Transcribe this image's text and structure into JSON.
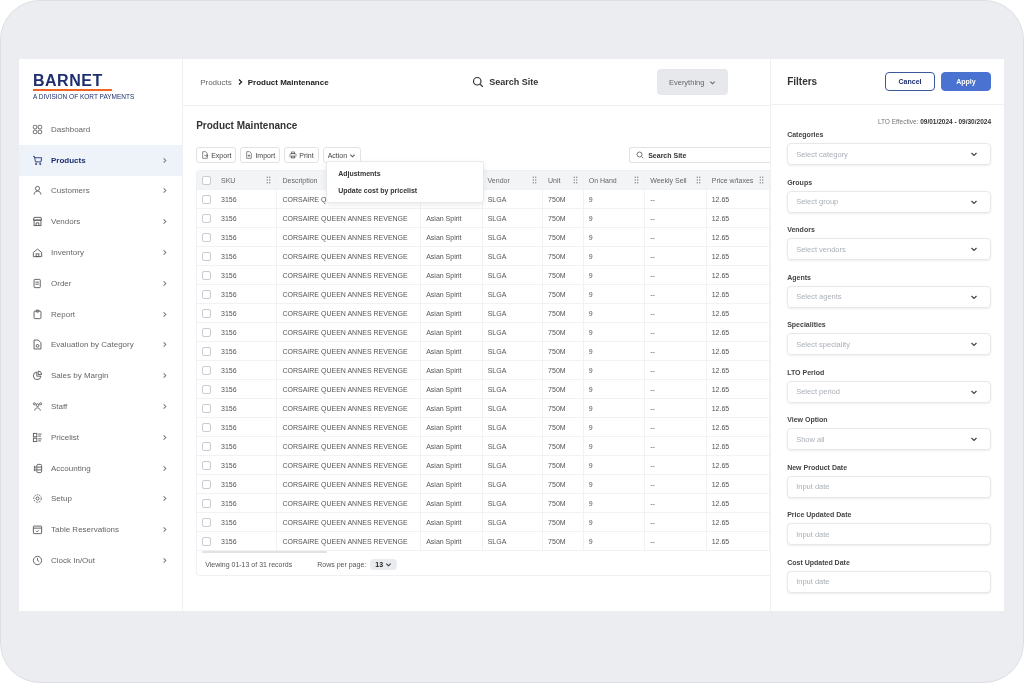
{
  "brand": {
    "name": "BARNET",
    "tagline": "A DIVISION OF KORT PAYMENTS"
  },
  "sidebar": {
    "items": [
      {
        "label": "Dashboard",
        "selected": false,
        "has_arrow": false
      },
      {
        "label": "Products",
        "selected": true,
        "has_arrow": true
      },
      {
        "label": "Customers",
        "selected": false,
        "has_arrow": true
      },
      {
        "label": "Vendors",
        "selected": false,
        "has_arrow": true
      },
      {
        "label": "Inventory",
        "selected": false,
        "has_arrow": true
      },
      {
        "label": "Order",
        "selected": false,
        "has_arrow": true
      },
      {
        "label": "Report",
        "selected": false,
        "has_arrow": true
      },
      {
        "label": "Evaluation by Category",
        "selected": false,
        "has_arrow": true
      },
      {
        "label": "Sales by Margin",
        "selected": false,
        "has_arrow": true
      },
      {
        "label": "Staff",
        "selected": false,
        "has_arrow": true
      },
      {
        "label": "Pricelist",
        "selected": false,
        "has_arrow": true
      },
      {
        "label": "Accounting",
        "selected": false,
        "has_arrow": true
      },
      {
        "label": "Setup",
        "selected": false,
        "has_arrow": true
      },
      {
        "label": "Table Reservations",
        "selected": false,
        "has_arrow": true
      },
      {
        "label": "Clock In/Out",
        "selected": false,
        "has_arrow": true
      }
    ]
  },
  "breadcrumb": [
    "Products",
    "Product Maintenance"
  ],
  "top_search": {
    "placeholder": "Search Site"
  },
  "scope_select": {
    "value": "Everything"
  },
  "page_title": "Product Maintenance",
  "toolbar": [
    {
      "label": "Export",
      "kind": "export"
    },
    {
      "label": "Import",
      "kind": "import"
    },
    {
      "label": "Print",
      "kind": "print"
    },
    {
      "label": "Action",
      "kind": "menu"
    }
  ],
  "action_menu": [
    "Adjustments",
    "Update cost by pricelist"
  ],
  "table_search": {
    "placeholder": "Search Site"
  },
  "table": {
    "all_checked": false,
    "columns": [
      {
        "label": "SKU"
      },
      {
        "label": "Description"
      },
      {},
      {
        "label": "Vendor"
      },
      {
        "label": "Unit"
      },
      {
        "label": "On Hand"
      },
      {
        "label": "Weekly Sell"
      },
      {
        "label": "Price w/taxes"
      }
    ],
    "rows": [
      {
        "checked": false,
        "cells": [
          "3156",
          "CORSAIRE Q",
          null,
          "SLGA",
          "750M",
          "9",
          "--",
          "12.65"
        ]
      },
      {
        "checked": false,
        "cells": [
          "3156",
          "CORSAIRE QUEEN ANNES REVENGE",
          "Asian Spirit",
          "SLGA",
          "750M",
          "9",
          "--",
          "12.65"
        ]
      },
      {
        "checked": false,
        "cells": [
          "3156",
          "CORSAIRE QUEEN ANNES REVENGE",
          "Asian Spirit",
          "SLGA",
          "750M",
          "9",
          "--",
          "12.65"
        ]
      },
      {
        "checked": false,
        "cells": [
          "3156",
          "CORSAIRE QUEEN ANNES REVENGE",
          "Asian Spirit",
          "SLGA",
          "750M",
          "9",
          "--",
          "12.65"
        ]
      },
      {
        "checked": false,
        "cells": [
          "3156",
          "CORSAIRE QUEEN ANNES REVENGE",
          "Asian Spirit",
          "SLGA",
          "750M",
          "9",
          "--",
          "12.65"
        ]
      },
      {
        "checked": false,
        "cells": [
          "3156",
          "CORSAIRE QUEEN ANNES REVENGE",
          "Asian Spirit",
          "SLGA",
          "750M",
          "9",
          "--",
          "12.65"
        ]
      },
      {
        "checked": false,
        "cells": [
          "3156",
          "CORSAIRE QUEEN ANNES REVENGE",
          "Asian Spirit",
          "SLGA",
          "750M",
          "9",
          "--",
          "12.65"
        ]
      },
      {
        "checked": false,
        "cells": [
          "3156",
          "CORSAIRE QUEEN ANNES REVENGE",
          "Asian Spirit",
          "SLGA",
          "750M",
          "9",
          "--",
          "12.65"
        ]
      },
      {
        "checked": false,
        "cells": [
          "3156",
          "CORSAIRE QUEEN ANNES REVENGE",
          "Asian Spirit",
          "SLGA",
          "750M",
          "9",
          "--",
          "12.65"
        ]
      },
      {
        "checked": false,
        "cells": [
          "3156",
          "CORSAIRE QUEEN ANNES REVENGE",
          "Asian Spirit",
          "SLGA",
          "750M",
          "9",
          "--",
          "12.65"
        ]
      },
      {
        "checked": false,
        "cells": [
          "3156",
          "CORSAIRE QUEEN ANNES REVENGE",
          "Asian Spirit",
          "SLGA",
          "750M",
          "9",
          "--",
          "12.65"
        ]
      },
      {
        "checked": false,
        "cells": [
          "3156",
          "CORSAIRE QUEEN ANNES REVENGE",
          "Asian Spirit",
          "SLGA",
          "750M",
          "9",
          "--",
          "12.65"
        ]
      },
      {
        "checked": false,
        "cells": [
          "3156",
          "CORSAIRE QUEEN ANNES REVENGE",
          "Asian Spirit",
          "SLGA",
          "750M",
          "9",
          "--",
          "12.65"
        ]
      },
      {
        "checked": false,
        "cells": [
          "3156",
          "CORSAIRE QUEEN ANNES REVENGE",
          "Asian Spirit",
          "SLGA",
          "750M",
          "9",
          "--",
          "12.65"
        ]
      },
      {
        "checked": false,
        "cells": [
          "3156",
          "CORSAIRE QUEEN ANNES REVENGE",
          "Asian Spirit",
          "SLGA",
          "750M",
          "9",
          "--",
          "12.65"
        ]
      },
      {
        "checked": false,
        "cells": [
          "3156",
          "CORSAIRE QUEEN ANNES REVENGE",
          "Asian Spirit",
          "SLGA",
          "750M",
          "9",
          "--",
          "12.65"
        ]
      },
      {
        "checked": false,
        "cells": [
          "3156",
          "CORSAIRE QUEEN ANNES REVENGE",
          "Asian Spirit",
          "SLGA",
          "750M",
          "9",
          "--",
          "12.65"
        ]
      },
      {
        "checked": false,
        "cells": [
          "3156",
          "CORSAIRE QUEEN ANNES REVENGE",
          "Asian Spirit",
          "SLGA",
          "750M",
          "9",
          "--",
          "12.65"
        ]
      },
      {
        "checked": false,
        "cells": [
          "3156",
          "CORSAIRE QUEEN ANNES REVENGE",
          "Asian Spirit",
          "SLGA",
          "750M",
          "9",
          "--",
          "12.65"
        ]
      }
    ]
  },
  "footer": {
    "viewing": "Viewing 01-13 of 31 records",
    "rows_label": "Rows per page:",
    "rows_value": "13"
  },
  "filters": {
    "title": "Filters",
    "buttons": [
      {
        "label": "Cancel",
        "kind": "secondary"
      },
      {
        "label": "Apply",
        "kind": "primary"
      }
    ],
    "lto_label": "LTO Effective:",
    "lto_value": "09/01/2024 - 09/30/2024",
    "fields": [
      {
        "label": "Categories",
        "placeholder": "Select category",
        "kind": "select"
      },
      {
        "label": "Groups",
        "placeholder": "Select group",
        "kind": "select"
      },
      {
        "label": "Vendors",
        "placeholder": "Select vendors",
        "kind": "select"
      },
      {
        "label": "Agents",
        "placeholder": "Select agents",
        "kind": "select"
      },
      {
        "label": "Specialities",
        "placeholder": "Select speciality",
        "kind": "select"
      },
      {
        "label": "LTO Period",
        "placeholder": "Select period",
        "kind": "select"
      },
      {
        "label": "View Option",
        "placeholder": "Show all",
        "kind": "select"
      },
      {
        "label": "New Product Date",
        "placeholder": "Input date",
        "kind": "date"
      },
      {
        "label": "Price Updated Date",
        "placeholder": "Input date",
        "kind": "date"
      },
      {
        "label": "Cost Updated Date",
        "placeholder": "Input date",
        "kind": "date"
      }
    ]
  }
}
